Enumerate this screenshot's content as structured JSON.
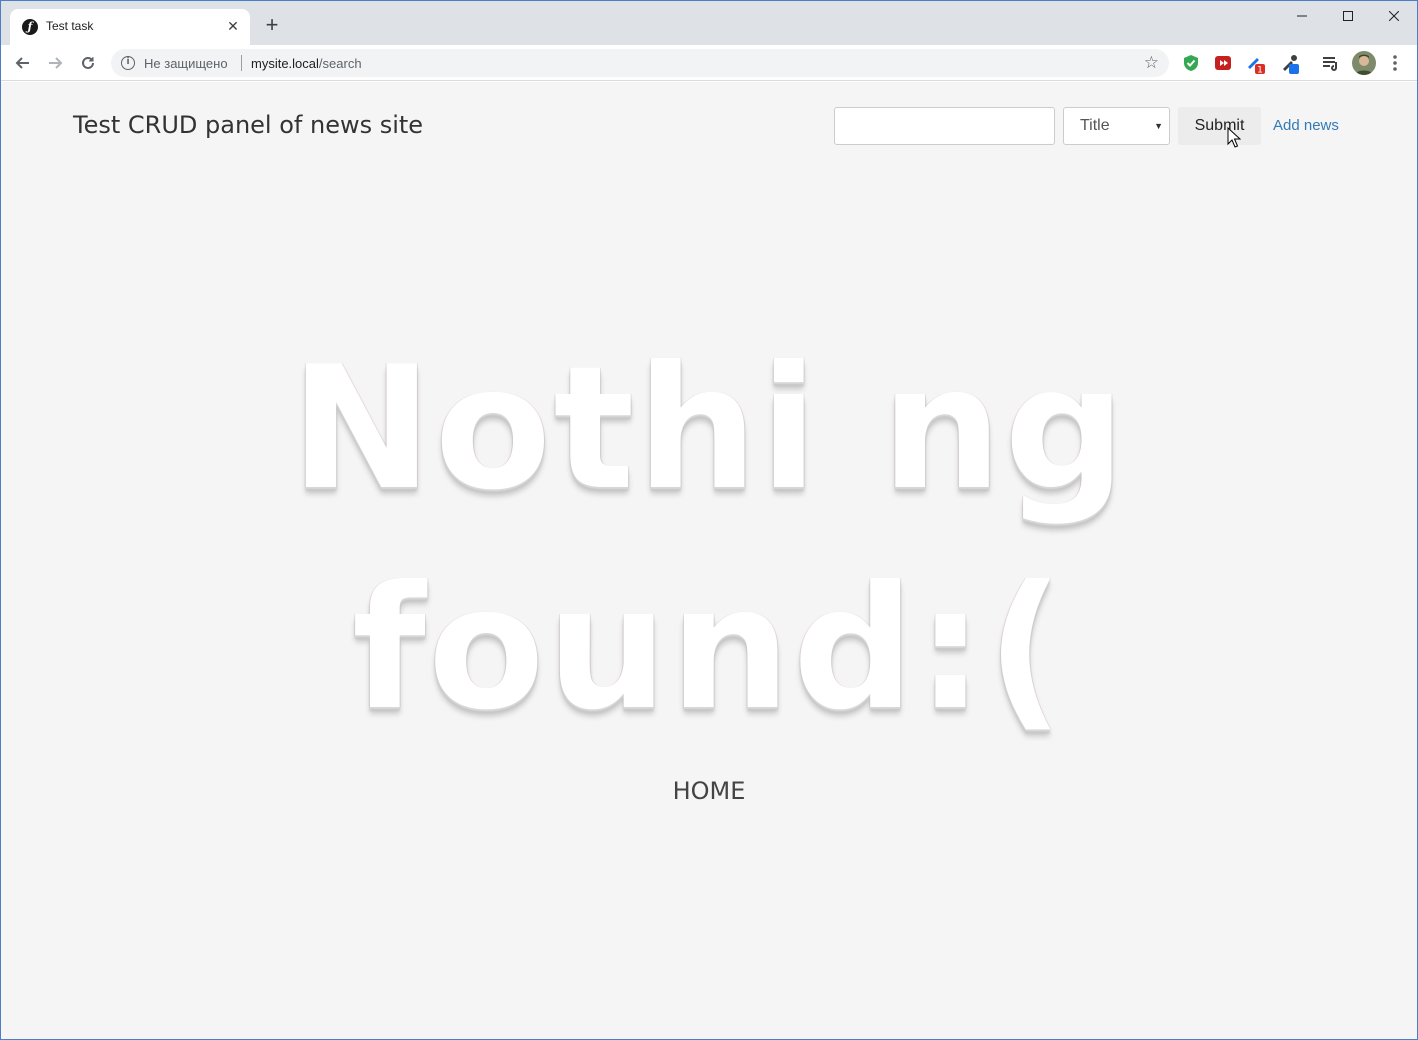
{
  "browser": {
    "tab_title": "Test task",
    "security_label": "Не защищено",
    "url_host": "mysite.local",
    "url_path": "/search",
    "extension_badge": "1"
  },
  "header": {
    "site_title": "Test CRUD panel of news site",
    "search_value": "",
    "search_field_selected": "Title",
    "submit_label": "Submit",
    "add_news_label": "Add news"
  },
  "main": {
    "message_line1": "Nothi ng",
    "message_line2": "found:(",
    "home_label": "HOME"
  }
}
